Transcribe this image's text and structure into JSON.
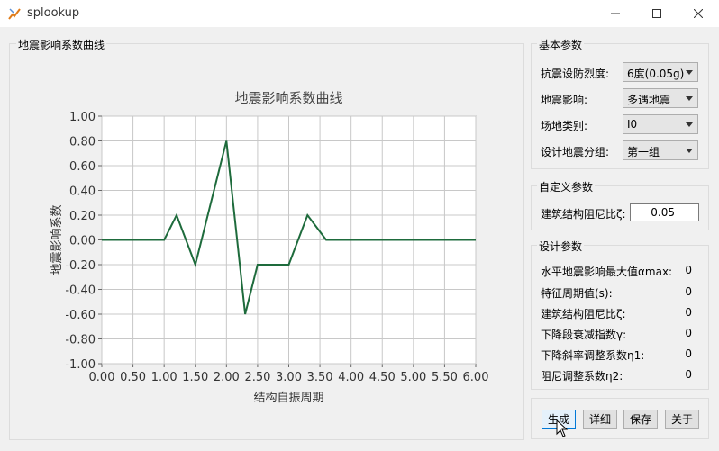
{
  "window": {
    "title": "splookup"
  },
  "chart_group": {
    "title": "地震影响系数曲线"
  },
  "chart_data": {
    "type": "line",
    "title": "地震影响系数曲线",
    "xlabel": "结构自振周期",
    "ylabel": "地震影响系数",
    "xlim": [
      0,
      6
    ],
    "ylim": [
      -1,
      1
    ],
    "x_ticks": [
      "0.00",
      "0.50",
      "1.00",
      "1.50",
      "2.00",
      "2.50",
      "3.00",
      "3.50",
      "4.00",
      "4.50",
      "5.00",
      "5.50",
      "6.00"
    ],
    "y_ticks": [
      "1.00",
      "0.80",
      "0.60",
      "0.40",
      "0.20",
      "0.00",
      "-0.20",
      "-0.40",
      "-0.60",
      "-0.80",
      "-1.00"
    ],
    "grid": true,
    "series": [
      {
        "x": [
          0,
          1.0,
          1.2,
          1.5,
          2.0,
          2.3,
          2.5,
          3.0,
          3.3,
          3.6,
          6.0
        ],
        "y": [
          0,
          0,
          0.2,
          -0.2,
          0.8,
          -0.6,
          -0.2,
          -0.2,
          0.2,
          0,
          0
        ],
        "color": "#1e6b3c"
      }
    ]
  },
  "basic_params": {
    "title": "基本参数",
    "rows": [
      {
        "label": "抗震设防烈度:",
        "value": "6度(0.05g)"
      },
      {
        "label": "地震影响:",
        "value": "多遇地震"
      },
      {
        "label": "场地类别:",
        "value": "I0"
      },
      {
        "label": "设计地震分组:",
        "value": "第一组"
      }
    ]
  },
  "custom_params": {
    "title": "自定义参数",
    "damping_label": "建筑结构阻尼比ζ:",
    "damping_value": "0.05"
  },
  "design_params": {
    "title": "设计参数",
    "rows": [
      {
        "label": "水平地震影响最大值αmax:",
        "value": "0"
      },
      {
        "label": "特征周期值(s):",
        "value": "0"
      },
      {
        "label": "建筑结构阻尼比ζ:",
        "value": "0"
      },
      {
        "label": "下降段衰减指数γ:",
        "value": "0"
      },
      {
        "label": "下降斜率调整系数η1:",
        "value": "0"
      },
      {
        "label": "阻尼调整系数η2:",
        "value": "0"
      }
    ]
  },
  "buttons": {
    "generate": "生成",
    "detail": "详细",
    "save": "保存",
    "about": "关于"
  }
}
